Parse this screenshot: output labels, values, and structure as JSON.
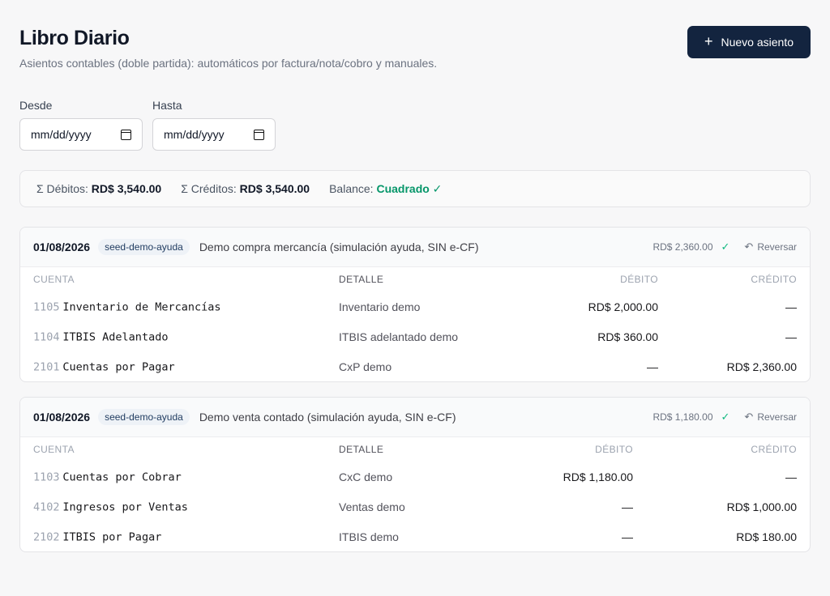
{
  "header": {
    "title": "Libro Diario",
    "subtitle": "Asientos contables (doble partida): automáticos por factura/nota/cobro y manuales.",
    "new_button_label": "Nuevo asiento",
    "new_button_icon": "plus-icon"
  },
  "filters": {
    "desde_label": "Desde",
    "desde_value": "mm/dd/yyyy",
    "hasta_label": "Hasta",
    "hasta_value": "mm/dd/yyyy",
    "date_icon": "calendar-icon"
  },
  "summary": {
    "debitos_label": "Σ Débitos:",
    "debitos_value": "RD$ 3,540.00",
    "creditos_label": "Σ Créditos:",
    "creditos_value": "RD$ 3,540.00",
    "balance_label": "Balance:",
    "balance_value": "Cuadrado ✓",
    "balance_color": "#059669"
  },
  "columns": {
    "cuenta": "CUENTA",
    "detalle": "DETALLE",
    "debito": "DÉBITO",
    "credito": "CRÉDITO"
  },
  "entries": [
    {
      "date": "01/08/2026",
      "tag": "seed-demo-ayuda",
      "description": "Demo compra mercancía (simulación ayuda, SIN e-CF)",
      "total": "RD$ 2,360.00",
      "check": "✓",
      "reverse_label": "Reversar",
      "lines": [
        {
          "code": "1105",
          "account": "Inventario de Mercancías",
          "detail": "Inventario demo",
          "debit": "RD$ 2,000.00",
          "credit": "—"
        },
        {
          "code": "1104",
          "account": "ITBIS Adelantado",
          "detail": "ITBIS adelantado demo",
          "debit": "RD$ 360.00",
          "credit": "—"
        },
        {
          "code": "2101",
          "account": "Cuentas por Pagar",
          "detail": "CxP demo",
          "debit": "—",
          "credit": "RD$ 2,360.00"
        }
      ]
    },
    {
      "date": "01/08/2026",
      "tag": "seed-demo-ayuda",
      "description": "Demo venta contado (simulación ayuda, SIN e-CF)",
      "total": "RD$ 1,180.00",
      "check": "✓",
      "reverse_label": "Reversar",
      "lines": [
        {
          "code": "1103",
          "account": "Cuentas por Cobrar",
          "detail": "CxC demo",
          "debit": "RD$ 1,180.00",
          "credit": "—"
        },
        {
          "code": "4102",
          "account": "Ingresos por Ventas",
          "detail": "Ventas demo",
          "debit": "—",
          "credit": "RD$ 1,000.00"
        },
        {
          "code": "2102",
          "account": "ITBIS por Pagar",
          "detail": "ITBIS demo",
          "debit": "—",
          "credit": "RD$ 180.00"
        }
      ]
    }
  ]
}
